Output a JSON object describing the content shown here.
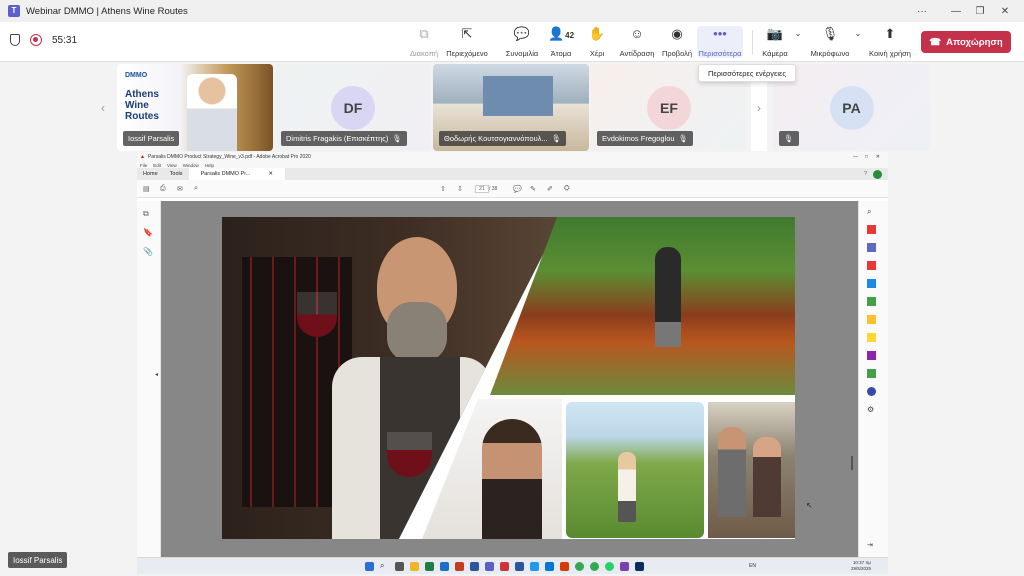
{
  "window": {
    "title": "Webinar DMMO | Athens Wine Routes",
    "more": "···",
    "minimize": "—",
    "restore": "❐",
    "close": "✕"
  },
  "meeting": {
    "timer": "55:31"
  },
  "toolbar": {
    "items": [
      {
        "label": "Διακοπή",
        "icon": "stop-share-icon"
      },
      {
        "label": "Περιεχόμενο",
        "icon": "content-icon"
      },
      {
        "label": "Συνομιλία",
        "icon": "chat-icon"
      },
      {
        "label": "Άτομα",
        "icon": "people-icon",
        "count": "42"
      },
      {
        "label": "Χέρι",
        "icon": "raise-hand-icon"
      },
      {
        "label": "Αντίδραση",
        "icon": "reaction-icon"
      },
      {
        "label": "Προβολή",
        "icon": "view-icon"
      },
      {
        "label": "Περισσότερα",
        "icon": "more-icon"
      },
      {
        "label": "Κάμερα",
        "icon": "camera-icon"
      },
      {
        "label": "Μικρόφωνο",
        "icon": "microphone-icon"
      },
      {
        "label": "Κοινή χρήση",
        "icon": "share-icon"
      }
    ],
    "leave_label": "Αποχώρηση",
    "tooltip": "Περισσότερες ενέργειες"
  },
  "participants": [
    {
      "name": "Iossif Parsalis",
      "initials": "",
      "video": true
    },
    {
      "name": "Dimitris Fragakis (Επισκέπτης)",
      "initials": "DF",
      "video": false
    },
    {
      "name": "Θοδωρής Κουτσογιαννόπουλ...",
      "initials": "",
      "video": true
    },
    {
      "name": "Evdokimos Fregoglou",
      "initials": "EF",
      "video": false
    },
    {
      "name": "",
      "initials": "PA",
      "video": false
    }
  ],
  "thumbnail_slide": {
    "logo": "DMMO",
    "title_line1": "Athens",
    "title_line2": "Wine Routes"
  },
  "shared": {
    "app_title": "Parsalis DMMO Product Strategy_Wine_v3.pdf - Adobe Acrobat Pro 2020",
    "menu": [
      "File",
      "Edit",
      "View",
      "Window",
      "Help"
    ],
    "tabs": [
      "Home",
      "Tools",
      "Parsalis DMMO Pr..."
    ],
    "page_current": "21",
    "page_total": "/ 38"
  },
  "taskbar": {
    "lang": "EN",
    "time": "10:37 πμ",
    "date": "29/5/2025"
  },
  "self_view_label": "Iossif Parsalis",
  "colors": {
    "accent": "#5b5fc7",
    "leave": "#c4314b",
    "avatar": "#d9d6f4"
  }
}
